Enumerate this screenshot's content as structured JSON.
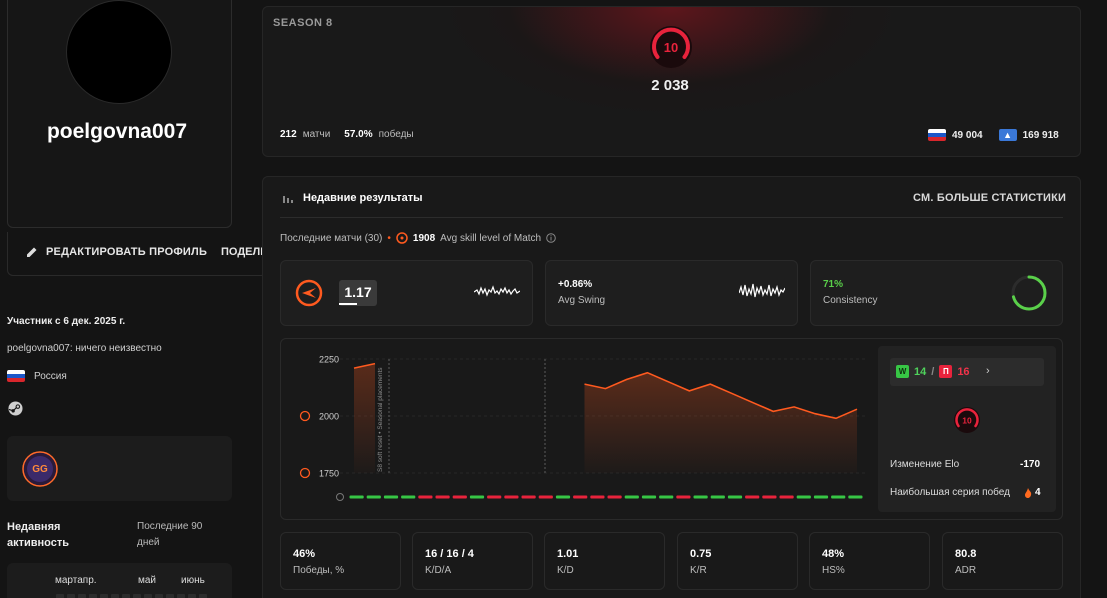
{
  "profile": {
    "username": "poelgovna007",
    "edit_label": "РЕДАКТИРОВАТЬ ПРОФИЛЬ",
    "share_label": "ПОДЕЛИТЬСЯ",
    "member_since": "Участник с 6 дек. 2025 г.",
    "bio": "poelgovna007: ничего неизвестно",
    "country": "Россия",
    "badge_text": "GG"
  },
  "activity": {
    "title": "Недавняя активность",
    "range": "Последние 90 дней",
    "months": [
      "мартапр.",
      "май",
      "июнь"
    ]
  },
  "season": {
    "label": "SEASON 8",
    "level": "10",
    "elo": "2 038",
    "matches_value": "212",
    "matches_label": "матчи",
    "winrate_value": "57.0%",
    "winrate_label": "победы",
    "country_rank": "49 004",
    "region_rank": "169 918"
  },
  "results": {
    "title": "Недавние результаты",
    "more_stats": "СМ. БОЛЬШЕ СТАТИСТИКИ",
    "last_matches": "Последние матчи (30)",
    "avg_skill_value": "1908",
    "avg_skill_label": "Avg skill level of Match",
    "kd": "1.17",
    "swing_value": "+0.86%",
    "swing_label": "Avg Swing",
    "consistency_value": "71%",
    "consistency_label": "Consistency",
    "wins": "14",
    "losses": "16",
    "w_letter": "W",
    "l_letter": "П",
    "elo_change_label": "Изменение Elo",
    "elo_change_value": "-170",
    "streak_label": "Наибольшая серия побед",
    "streak_value": "4"
  },
  "chart_data": {
    "type": "line",
    "y_ticks": [
      "2250",
      "2000",
      "1750"
    ],
    "ylim": [
      1750,
      2250
    ],
    "annotation": "S8 soft reset • Seasonal placements",
    "series": [
      {
        "values": [
          2210,
          2230,
          null,
          null,
          null,
          null,
          null,
          null,
          null,
          null,
          null,
          2140,
          2120,
          2160,
          2190,
          2150,
          2110,
          2140,
          2100,
          2060,
          2020,
          2040,
          2010,
          1990,
          2030
        ]
      }
    ],
    "results": [
      "W",
      "W",
      "W",
      "W",
      "L",
      "L",
      "L",
      "W",
      "L",
      "L",
      "L",
      "L",
      "W",
      "L",
      "L",
      "L",
      "W",
      "W",
      "W",
      "L",
      "W",
      "W",
      "W",
      "L",
      "L",
      "L",
      "W",
      "W",
      "W",
      "W"
    ]
  },
  "stats": [
    {
      "value": "46%",
      "label": "Победы, %"
    },
    {
      "value": "16 / 16 / 4",
      "label": "K/D/A"
    },
    {
      "value": "1.01",
      "label": "K/D"
    },
    {
      "value": "0.75",
      "label": "K/R"
    },
    {
      "value": "48%",
      "label": "HS%"
    },
    {
      "value": "80.8",
      "label": "ADR"
    }
  ],
  "colors": {
    "accent": "#ff5a1f",
    "win": "#37c645",
    "loss": "#e8233c",
    "level_red": "#e8233c"
  }
}
